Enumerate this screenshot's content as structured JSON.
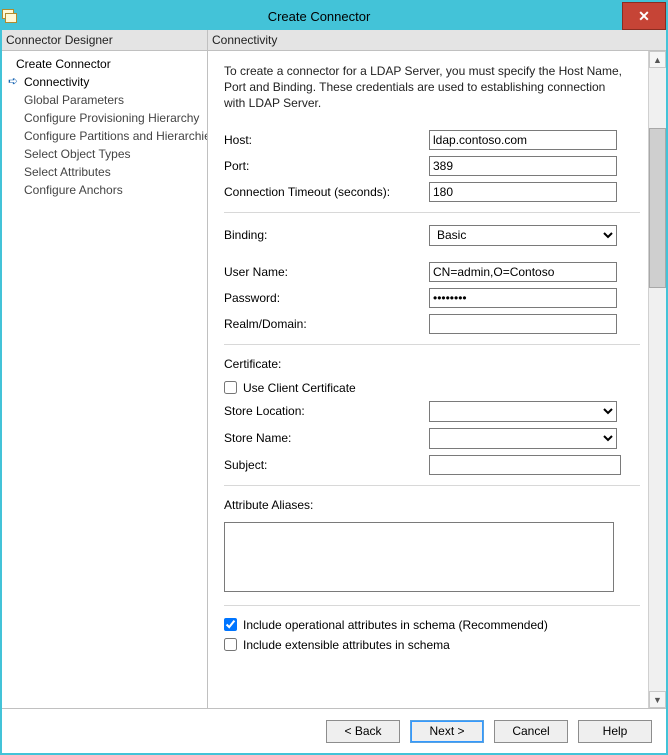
{
  "window": {
    "title": "Create Connector"
  },
  "left_panel": {
    "header": "Connector Designer",
    "items": [
      {
        "label": "Create Connector",
        "indent": "top"
      },
      {
        "label": "Connectivity",
        "indent": "sub",
        "current": true
      },
      {
        "label": "Global Parameters",
        "indent": "sub"
      },
      {
        "label": "Configure Provisioning Hierarchy",
        "indent": "sub"
      },
      {
        "label": "Configure Partitions and Hierarchies",
        "indent": "sub"
      },
      {
        "label": "Select Object Types",
        "indent": "sub"
      },
      {
        "label": "Select Attributes",
        "indent": "sub"
      },
      {
        "label": "Configure Anchors",
        "indent": "sub"
      }
    ]
  },
  "right_panel": {
    "header": "Connectivity",
    "intro": "To create a connector for a LDAP Server, you must specify the Host Name, Port and Binding. These credentials are used to establishing connection with LDAP Server."
  },
  "fields": {
    "host": {
      "label": "Host:",
      "value": "ldap.contoso.com"
    },
    "port": {
      "label": "Port:",
      "value": "389"
    },
    "timeout": {
      "label": "Connection Timeout (seconds):",
      "value": "180"
    },
    "binding": {
      "label": "Binding:",
      "value": "Basic"
    },
    "username": {
      "label": "User Name:",
      "value": "CN=admin,O=Contoso"
    },
    "password": {
      "label": "Password:",
      "value": "********"
    },
    "realm": {
      "label": "Realm/Domain:",
      "value": ""
    },
    "certificate_section": "Certificate:",
    "use_client_cert": {
      "label": "Use Client Certificate",
      "checked": false
    },
    "store_location": {
      "label": "Store Location:",
      "value": ""
    },
    "store_name": {
      "label": "Store Name:",
      "value": ""
    },
    "subject": {
      "label": "Subject:",
      "value": ""
    },
    "aliases_section": "Attribute Aliases:",
    "aliases_value": "",
    "include_operational": {
      "label": "Include operational attributes in schema (Recommended)",
      "checked": true
    },
    "include_extensible": {
      "label": "Include extensible attributes in schema",
      "checked": false
    }
  },
  "footer": {
    "back": "<  Back",
    "next": "Next  >",
    "cancel": "Cancel",
    "help": "Help"
  }
}
